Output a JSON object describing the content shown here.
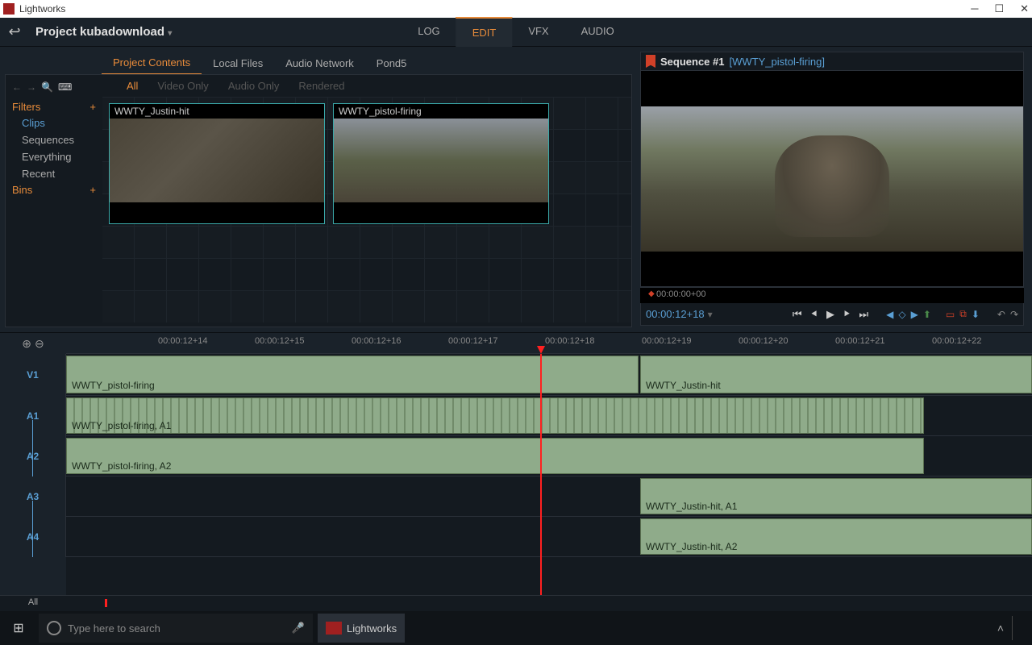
{
  "window": {
    "title": "Lightworks"
  },
  "project": {
    "label": "Project kubadownload"
  },
  "mode_tabs": {
    "log": "LOG",
    "edit": "EDIT",
    "vfx": "VFX",
    "audio": "AUDIO"
  },
  "content_tabs": {
    "project": "Project Contents",
    "local": "Local Files",
    "network": "Audio Network",
    "pond5": "Pond5"
  },
  "filter_tabs": {
    "all": "All",
    "video": "Video Only",
    "audio": "Audio Only",
    "rendered": "Rendered"
  },
  "sidebar": {
    "filters": "Filters",
    "items": {
      "clips": "Clips",
      "sequences": "Sequences",
      "everything": "Everything",
      "recent": "Recent"
    },
    "bins": "Bins"
  },
  "clips": {
    "c1": "WWTY_Justin-hit",
    "c2": "WWTY_pistol-firing"
  },
  "viewer": {
    "seq_label": "Sequence #1",
    "seq_file": "[WWTY_pistol-firing]",
    "scrub_time": "00:00:00+00",
    "timecode": "00:00:12+18"
  },
  "timeline": {
    "ticks": {
      "t1": "00:00:12+14",
      "t2": "00:00:12+15",
      "t3": "00:00:12+16",
      "t4": "00:00:12+17",
      "t5": "00:00:12+18",
      "t6": "00:00:12+19",
      "t7": "00:00:12+20",
      "t8": "00:00:12+21",
      "t9": "00:00:12+22"
    },
    "tracks": {
      "v1": "V1",
      "a1": "A1",
      "a2": "A2",
      "a3": "A3",
      "a4": "A4"
    },
    "clips": {
      "v1a": "WWTY_pistol-firing",
      "v1b": "WWTY_Justin-hit",
      "a1a": "WWTY_pistol-firing, A1",
      "a2a": "WWTY_pistol-firing, A2",
      "a3a": "WWTY_Justin-hit, A1",
      "a4a": "WWTY_Justin-hit, A2"
    },
    "all": "All"
  },
  "taskbar": {
    "search_placeholder": "Type here to search",
    "app": "Lightworks"
  }
}
